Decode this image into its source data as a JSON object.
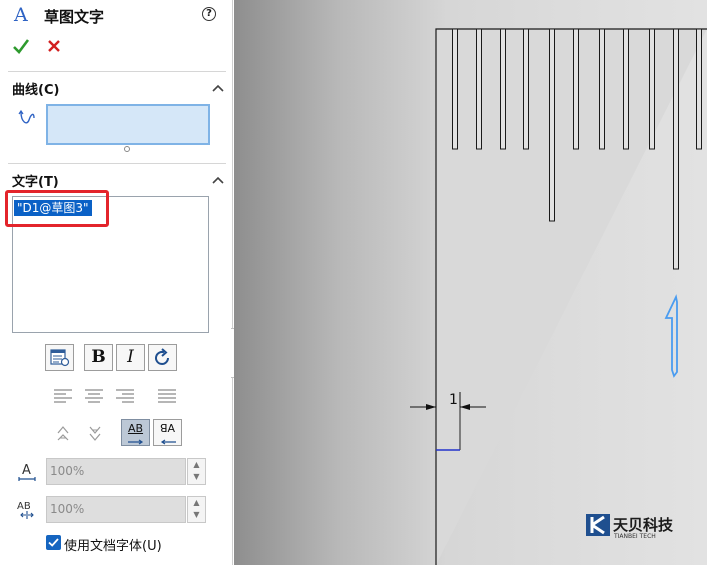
{
  "panel": {
    "title": "草图文字",
    "help_label": "?",
    "curves_section": {
      "title": "曲线(C)"
    },
    "text_section": {
      "title": "文字(T)",
      "text_value": "\"D1@草图3\""
    },
    "format_buttons": [
      {
        "label": "",
        "icon": "link-to-property-icon"
      },
      {
        "label": "B",
        "icon": "bold-icon"
      },
      {
        "label": "I",
        "icon": "italic-icon"
      },
      {
        "label": "",
        "icon": "rotate-icon"
      }
    ],
    "alignment": [
      "align-left-icon",
      "align-center-icon",
      "align-right-icon",
      "justify-icon"
    ],
    "width_factor": {
      "value": "100%"
    },
    "spacing": {
      "value": "100%"
    },
    "use_doc_font": {
      "label": "使用文档字体(U)",
      "checked": true
    }
  },
  "graphics": {
    "dimension_value": "1",
    "sketch_text_glyph": "1",
    "watermark": {
      "cn": "天贝科技",
      "en": "TIANBEI TECH"
    }
  },
  "colors": {
    "accent": "#0a61c6",
    "highlight": "#e3242b",
    "sketch_blue": "#4a9cf0"
  }
}
